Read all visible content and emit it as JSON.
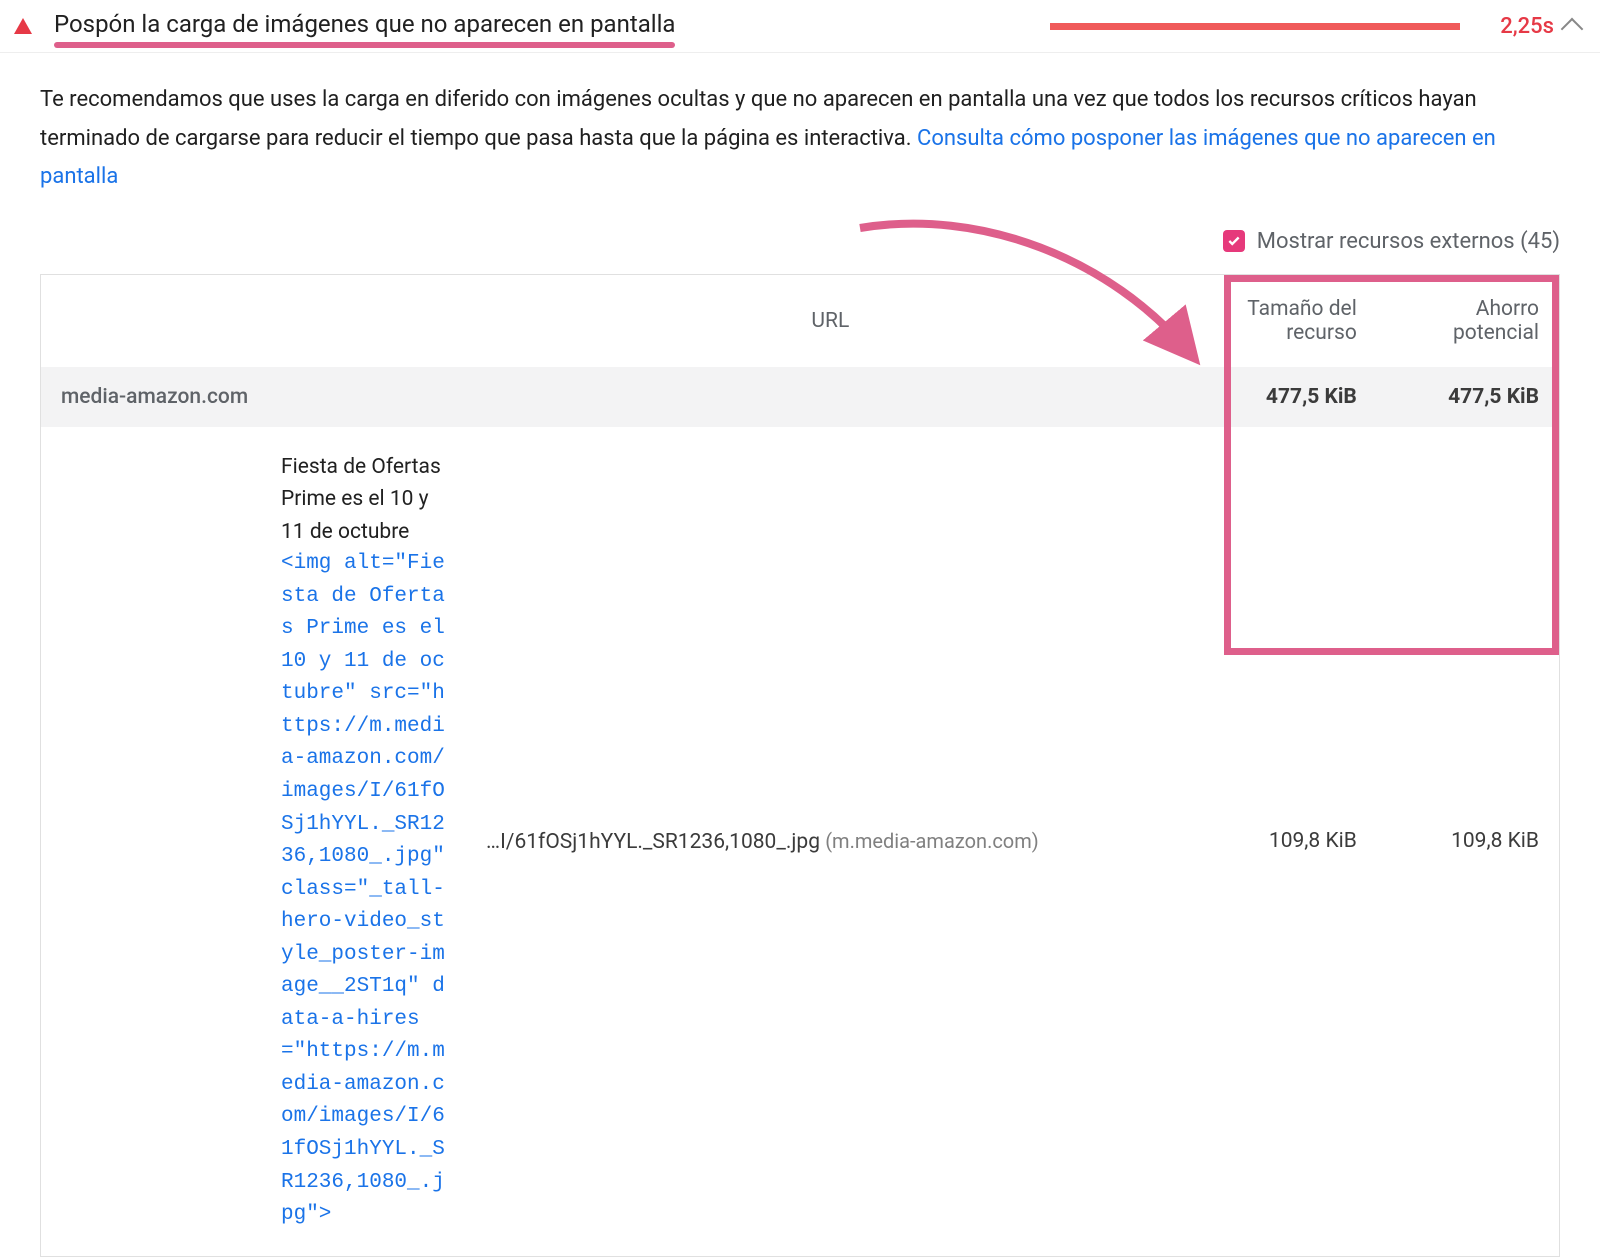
{
  "audit": {
    "title": "Pospón la carga de imágenes que no aparecen en pantalla",
    "time": "2,25s",
    "description_text": "Te recomendamos que uses la carga en diferido con imágenes ocultas y que no aparecen en pantalla una vez que todos los recursos críticos hayan terminado de cargarse para reducir el tiempo que pasa hasta que la página es interactiva. ",
    "description_link": "Consulta cómo posponer las imágenes que no aparecen en pantalla"
  },
  "externals": {
    "label": "Mostrar recursos externos (45)"
  },
  "columns": {
    "url": "URL",
    "resource_size": "Tamaño del recurso",
    "potential_savings": "Ahorro potencial"
  },
  "group": {
    "host": "media-amazon.com",
    "resource_size": "477,5 KiB",
    "potential_savings": "477,5 KiB"
  },
  "item": {
    "alt_text": "Fiesta de Ofertas Prime es el 10 y 11 de octubre",
    "code_snippet": "<img alt=\"Fiesta de Ofertas Prime es el 10 y 11 de octubre\" src=\"https://m.media-amazon.com/images/I/61fOSj1hYYL._SR1236,1080_.jpg\" class=\"_tall-hero-video_style_poster-image__2ST1q\" data-a-hires=\"https://m.media-amazon.com/images/I/61fOSj1hYYL._SR1236,1080_.jpg\">",
    "url_short": "…I/61fOSj1hYYL._SR1236,1080_.jpg",
    "url_host": "(m.media-amazon.com)",
    "resource_size": "109,8 KiB",
    "potential_savings": "109,8 KiB"
  }
}
